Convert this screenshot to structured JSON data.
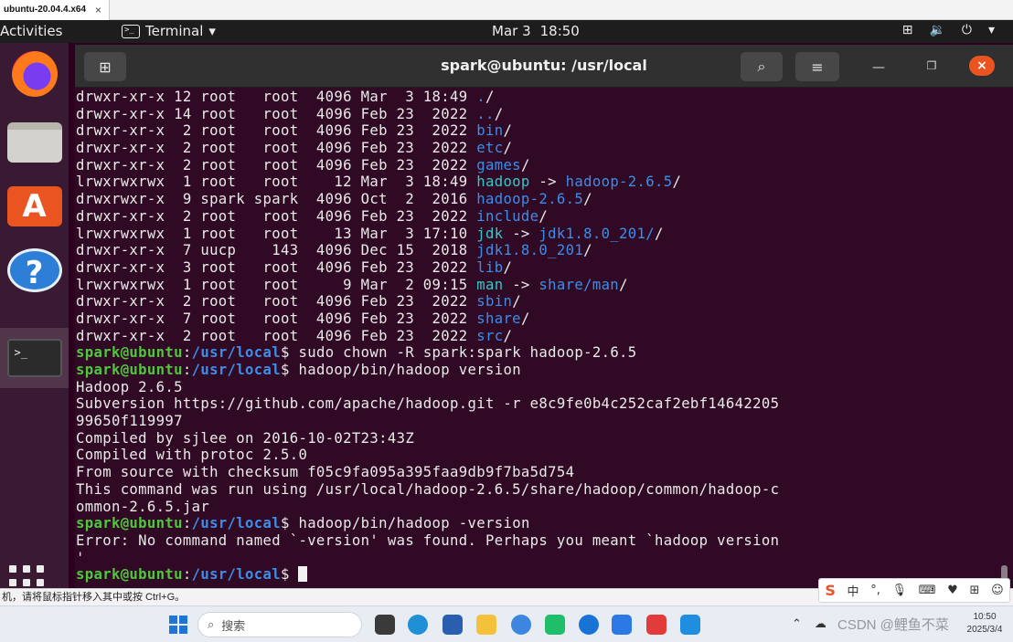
{
  "vm": {
    "tab_title": "ubuntu-20.04.4.x64",
    "tab_close": "×"
  },
  "topbar": {
    "activities": "Activities",
    "app_menu": "Terminal",
    "date": "Mar 3",
    "time": "18:50"
  },
  "terminal": {
    "title": "spark@ubuntu: /usr/local",
    "prompt_user": "spark@ubuntu",
    "prompt_colon": ":",
    "prompt_path": "/usr/local",
    "prompt_symbol": "$ ",
    "listing": [
      {
        "perm": "drwxr-xr-x",
        "links": "12",
        "owner": "root",
        "group": "root",
        "size": "4096",
        "month": "Mar",
        "day": "3",
        "time": "18:49",
        "name": "./",
        "kind": "dir"
      },
      {
        "perm": "drwxr-xr-x",
        "links": "14",
        "owner": "root",
        "group": "root",
        "size": "4096",
        "month": "Feb",
        "day": "23",
        "time": "2022",
        "name": "../",
        "kind": "dir"
      },
      {
        "perm": "drwxr-xr-x",
        "links": "2",
        "owner": "root",
        "group": "root",
        "size": "4096",
        "month": "Feb",
        "day": "23",
        "time": "2022",
        "name": "bin/",
        "kind": "dir"
      },
      {
        "perm": "drwxr-xr-x",
        "links": "2",
        "owner": "root",
        "group": "root",
        "size": "4096",
        "month": "Feb",
        "day": "23",
        "time": "2022",
        "name": "etc/",
        "kind": "dir"
      },
      {
        "perm": "drwxr-xr-x",
        "links": "2",
        "owner": "root",
        "group": "root",
        "size": "4096",
        "month": "Feb",
        "day": "23",
        "time": "2022",
        "name": "games/",
        "kind": "dir"
      },
      {
        "perm": "lrwxrwxrwx",
        "links": "1",
        "owner": "root",
        "group": "root",
        "size": "12",
        "month": "Mar",
        "day": "3",
        "time": "18:49",
        "name": "hadoop",
        "target": "hadoop-2.6.5/",
        "kind": "link"
      },
      {
        "perm": "drwxrwxr-x",
        "links": "9",
        "owner": "spark",
        "group": "spark",
        "size": "4096",
        "month": "Oct",
        "day": "2",
        "time": "2016",
        "name": "hadoop-2.6.5/",
        "kind": "dir"
      },
      {
        "perm": "drwxr-xr-x",
        "links": "2",
        "owner": "root",
        "group": "root",
        "size": "4096",
        "month": "Feb",
        "day": "23",
        "time": "2022",
        "name": "include/",
        "kind": "dir"
      },
      {
        "perm": "lrwxrwxrwx",
        "links": "1",
        "owner": "root",
        "group": "root",
        "size": "13",
        "month": "Mar",
        "day": "3",
        "time": "17:10",
        "name": "jdk",
        "target": "jdk1.8.0_201//",
        "kind": "link"
      },
      {
        "perm": "drwxr-xr-x",
        "links": "7",
        "owner": "uucp",
        "group": "143",
        "size": "4096",
        "month": "Dec",
        "day": "15",
        "time": "2018",
        "name": "jdk1.8.0_201/",
        "kind": "dir"
      },
      {
        "perm": "drwxr-xr-x",
        "links": "3",
        "owner": "root",
        "group": "root",
        "size": "4096",
        "month": "Feb",
        "day": "23",
        "time": "2022",
        "name": "lib/",
        "kind": "dir"
      },
      {
        "perm": "lrwxrwxrwx",
        "links": "1",
        "owner": "root",
        "group": "root",
        "size": "9",
        "month": "Mar",
        "day": "2",
        "time": "09:15",
        "name": "man",
        "target": "share/man/",
        "kind": "link"
      },
      {
        "perm": "drwxr-xr-x",
        "links": "2",
        "owner": "root",
        "group": "root",
        "size": "4096",
        "month": "Feb",
        "day": "23",
        "time": "2022",
        "name": "sbin/",
        "kind": "dir"
      },
      {
        "perm": "drwxr-xr-x",
        "links": "7",
        "owner": "root",
        "group": "root",
        "size": "4096",
        "month": "Feb",
        "day": "23",
        "time": "2022",
        "name": "share/",
        "kind": "dir"
      },
      {
        "perm": "drwxr-xr-x",
        "links": "2",
        "owner": "root",
        "group": "root",
        "size": "4096",
        "month": "Feb",
        "day": "23",
        "time": "2022",
        "name": "src/",
        "kind": "dir"
      }
    ],
    "cmd1": "sudo chown -R spark:spark hadoop-2.6.5",
    "cmd2": "hadoop/bin/hadoop version",
    "output2": [
      "Hadoop 2.6.5",
      "Subversion https://github.com/apache/hadoop.git -r e8c9fe0b4c252caf2ebf14642205",
      "99650f119997",
      "Compiled by sjlee on 2016-10-02T23:43Z",
      "Compiled with protoc 2.5.0",
      "From source with checksum f05c9fa095a395faa9db9f7ba5d754",
      "This command was run using /usr/local/hadoop-2.6.5/share/hadoop/common/hadoop-c",
      "ommon-2.6.5.jar"
    ],
    "cmd3": "hadoop/bin/hadoop -version",
    "output3": [
      "Error: No command named `-version' was found. Perhaps you meant `hadoop version",
      "'"
    ]
  },
  "windows": {
    "hint": "机，请将鼠标指针移入其中或按 Ctrl+G。",
    "search_placeholder": "搜索",
    "clock_time": "10:50",
    "clock_date": "2025/3/4",
    "ime_mode": "中",
    "watermark": "CSDN @鲤鱼不菜"
  },
  "colors": {
    "terminal_bg": "#300a24",
    "prompt_user": "#4fc73a",
    "prompt_path": "#3b8eea",
    "directory": "#3b8eea",
    "symlink": "#34c9c9",
    "close_button": "#e95420"
  }
}
